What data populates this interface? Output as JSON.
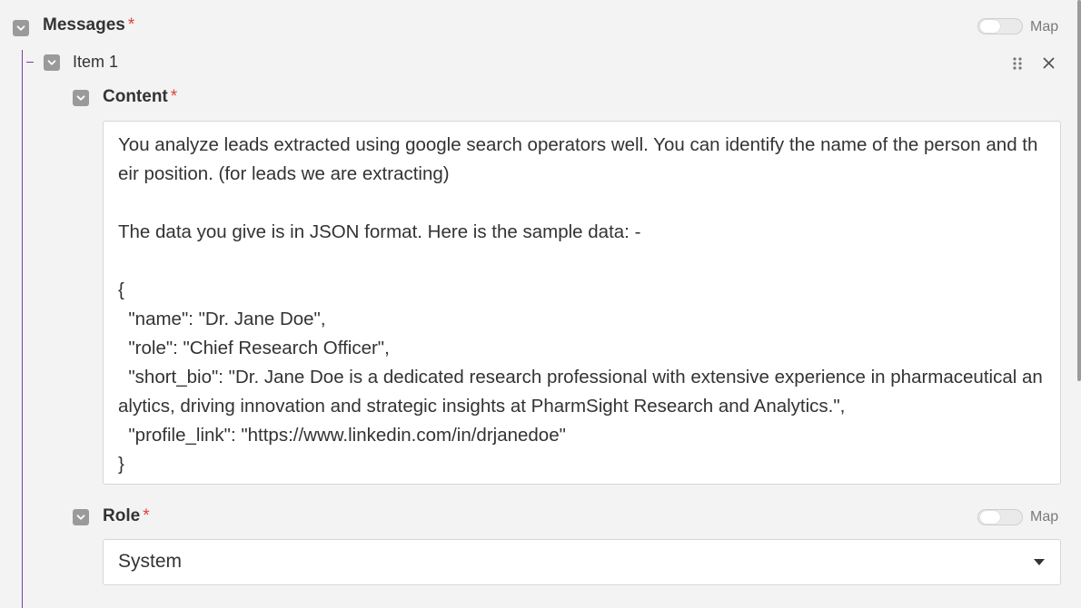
{
  "messages": {
    "title": "Messages",
    "required_mark": "*",
    "map_label": "Map"
  },
  "item": {
    "title": "Item 1"
  },
  "content": {
    "label": "Content",
    "required_mark": "*",
    "value": "You analyze leads extracted using google search operators well. You can identify the name of the person and their position. (for leads we are extracting)\n\nThe data you give is in JSON format. Here is the sample data: -\n\n{\n  \"name\": \"Dr. Jane Doe\",\n  \"role\": \"Chief Research Officer\",\n  \"short_bio\": \"Dr. Jane Doe is a dedicated research professional with extensive experience in pharmaceutical analytics, driving innovation and strategic insights at PharmSight Research and Analytics.\",\n  \"profile_link\": \"https://www.linkedin.com/in/drjanedoe\"\n}"
  },
  "role": {
    "label": "Role",
    "required_mark": "*",
    "map_label": "Map",
    "selected": "System"
  },
  "colors": {
    "accent_line": "#7a3fa6",
    "required": "#e0413b",
    "checkbox": "#9a9a9a"
  },
  "icons": {
    "collapse": "chevron-down-icon",
    "drag": "drag-handle-icon",
    "remove": "close-icon",
    "dropdown": "caret-down-icon"
  }
}
